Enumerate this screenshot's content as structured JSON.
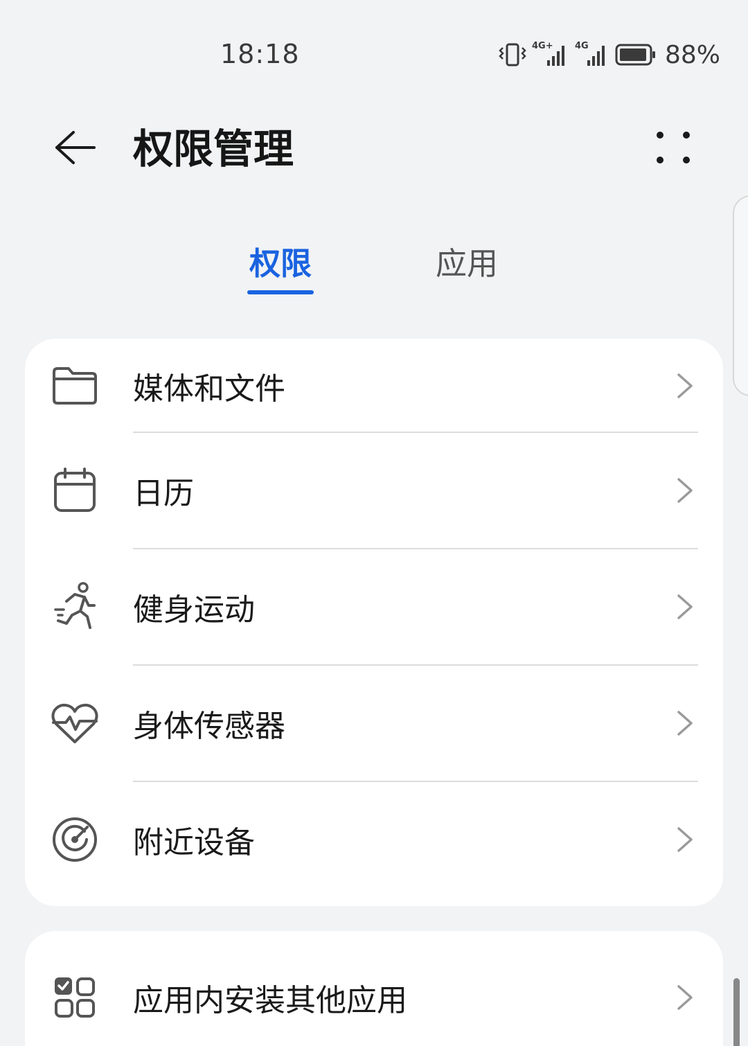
{
  "status_bar": {
    "time": "18:18",
    "network_1": "4G+",
    "network_2": "4G",
    "battery": "88%",
    "icons": [
      "vibrate-icon",
      "signal-icon",
      "signal-icon",
      "battery-icon"
    ]
  },
  "header": {
    "title": "权限管理",
    "back_icon": "back-arrow-icon",
    "more_icon": "more-icon"
  },
  "tabs": [
    {
      "label": "权限",
      "active": true
    },
    {
      "label": "应用",
      "active": false
    }
  ],
  "permissions": [
    {
      "label": "媒体和文件",
      "icon": "folder-icon"
    },
    {
      "label": "日历",
      "icon": "calendar-icon"
    },
    {
      "label": "健身运动",
      "icon": "running-icon"
    },
    {
      "label": "身体传感器",
      "icon": "heart-rate-icon"
    },
    {
      "label": "附近设备",
      "icon": "radar-icon"
    }
  ],
  "other": [
    {
      "label": "应用内安装其他应用",
      "icon": "apps-grid-icon"
    }
  ],
  "colors": {
    "accent": "#1a63e0",
    "background": "#f1f3f5",
    "card": "#ffffff"
  }
}
